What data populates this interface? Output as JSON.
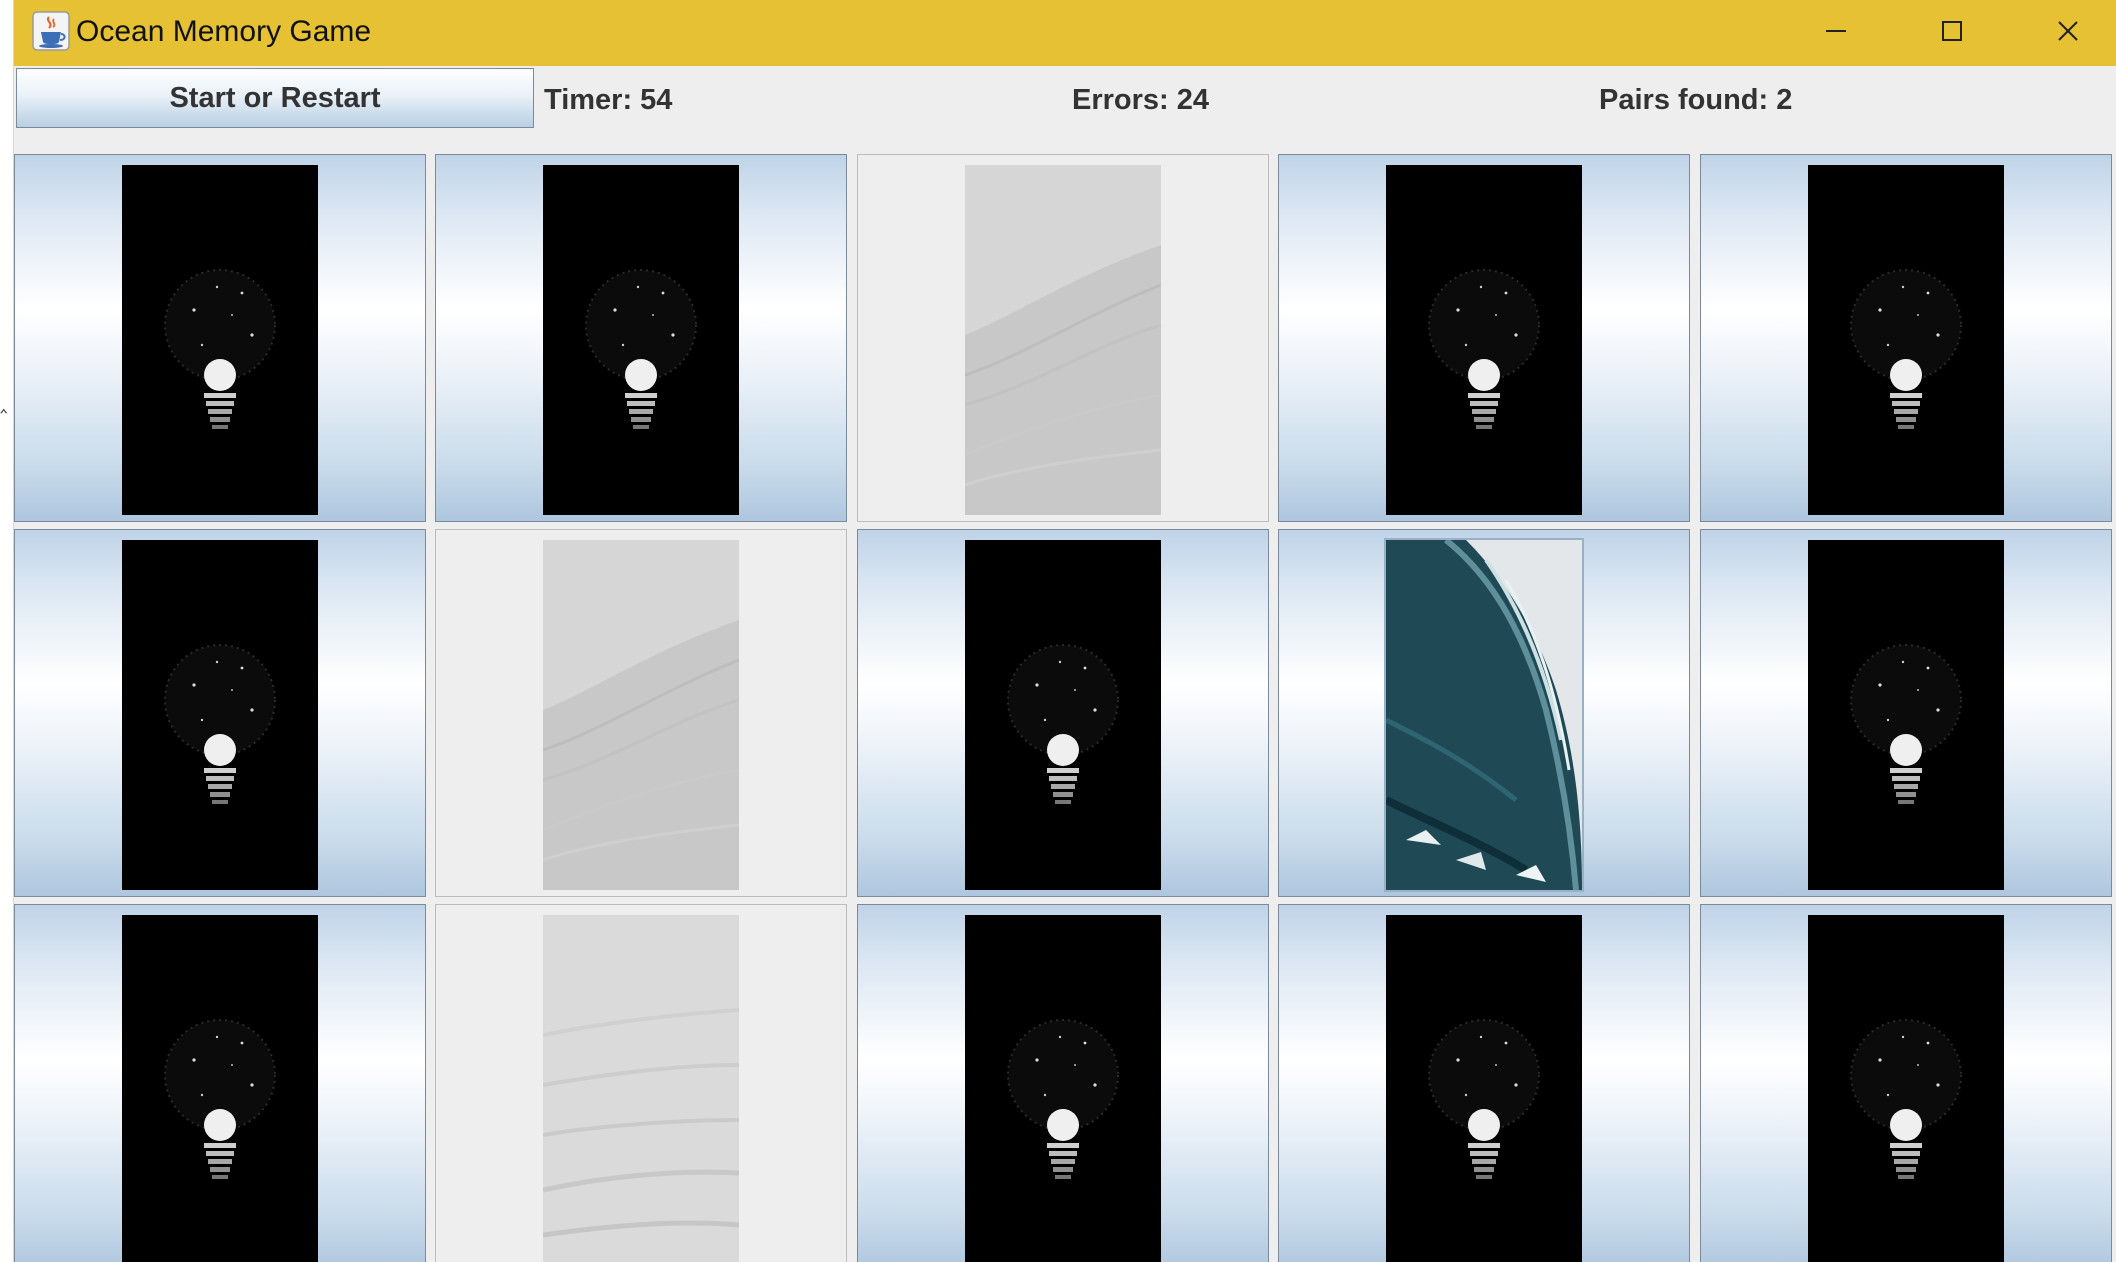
{
  "window": {
    "title": "Ocean Memory Game",
    "app_icon": "java-coffee-cup-icon",
    "titlebar_color": "#e6c133",
    "controls": [
      "minimize-icon",
      "maximize-icon",
      "close-icon"
    ]
  },
  "toolbar": {
    "start_label": "Start or Restart",
    "timer_text": "Timer: 54",
    "errors_text": "Errors: 24",
    "pairs_text": "Pairs found: 2"
  },
  "board": {
    "rows": 3,
    "columns": 5,
    "cards": [
      {
        "row": 1,
        "col": 1,
        "state": "face-down",
        "image": "moon-bulb-icon"
      },
      {
        "row": 1,
        "col": 2,
        "state": "face-down",
        "image": "moon-bulb-icon"
      },
      {
        "row": 1,
        "col": 3,
        "state": "matched",
        "image": "faded-wave-image"
      },
      {
        "row": 1,
        "col": 4,
        "state": "face-down",
        "image": "moon-bulb-icon"
      },
      {
        "row": 1,
        "col": 5,
        "state": "face-down",
        "image": "moon-bulb-icon"
      },
      {
        "row": 2,
        "col": 1,
        "state": "face-down",
        "image": "moon-bulb-icon"
      },
      {
        "row": 2,
        "col": 2,
        "state": "matched",
        "image": "faded-wave-image"
      },
      {
        "row": 2,
        "col": 3,
        "state": "face-down",
        "image": "moon-bulb-icon"
      },
      {
        "row": 2,
        "col": 4,
        "state": "face-up",
        "image": "ocean-wave-image"
      },
      {
        "row": 2,
        "col": 5,
        "state": "face-down",
        "image": "moon-bulb-icon"
      },
      {
        "row": 3,
        "col": 1,
        "state": "face-down",
        "image": "moon-bulb-icon"
      },
      {
        "row": 3,
        "col": 2,
        "state": "matched",
        "image": "faded-surf-image"
      },
      {
        "row": 3,
        "col": 3,
        "state": "face-down",
        "image": "moon-bulb-icon"
      },
      {
        "row": 3,
        "col": 4,
        "state": "face-down",
        "image": "moon-bulb-icon"
      },
      {
        "row": 3,
        "col": 5,
        "state": "face-down",
        "image": "moon-bulb-icon"
      }
    ]
  }
}
